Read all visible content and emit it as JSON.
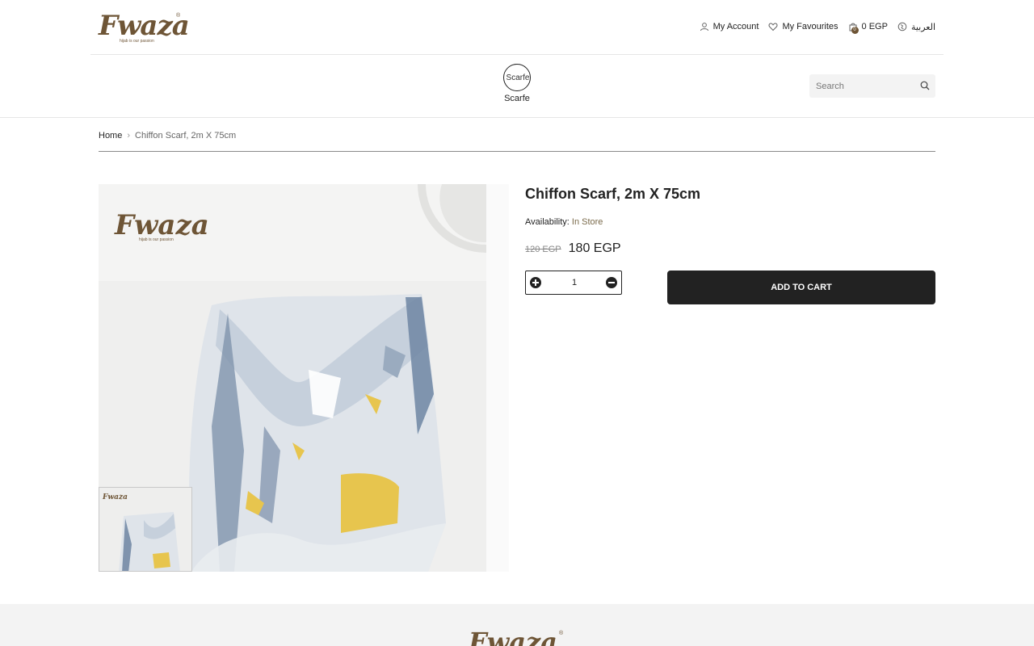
{
  "brand": {
    "logo_text": "Fwaza",
    "tagline": "hijab is our passion",
    "registered_mark": "®",
    "accent_color": "#6e5536"
  },
  "header": {
    "account_label": "My Account",
    "account_icon": "user-icon",
    "favourites_label": "My Favourites",
    "favourites_icon": "heart-icon",
    "cart_total": "0 EGP",
    "cart_count": "0",
    "cart_icon": "shopping-bag-icon",
    "language_label": "العربية",
    "language_icon": "globe-icon"
  },
  "nav": {
    "categories": [
      {
        "label": "Scarfe",
        "image_alt": "Scarfe"
      }
    ]
  },
  "search": {
    "placeholder": "Search",
    "icon": "search-icon"
  },
  "breadcrumb": {
    "home": "Home",
    "separator": "›",
    "current": "Chiffon Scarf, 2m X 75cm"
  },
  "product": {
    "title": "Chiffon Scarf, 2m X 75cm",
    "availability_label": "Availability:",
    "availability_value": "In Store",
    "old_price": "120 EGP",
    "price": "180 EGP",
    "quantity": "1",
    "add_to_cart_label": "ADD TO CART"
  },
  "colors": {
    "button_dark": "#222222",
    "availability": "#7a6a4a"
  }
}
